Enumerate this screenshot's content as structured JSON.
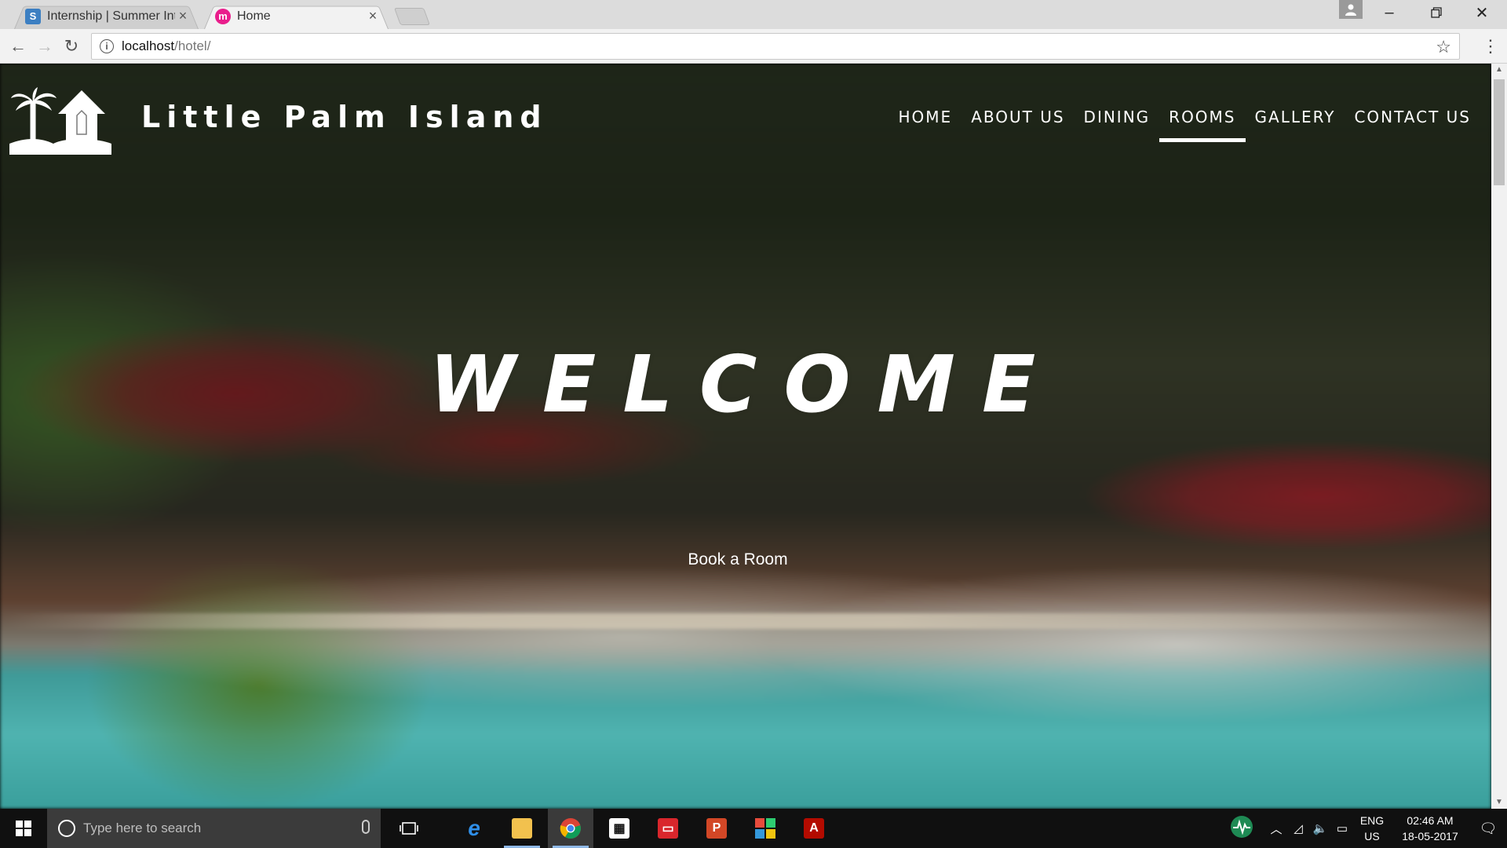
{
  "browser": {
    "tabs": [
      {
        "title": "Internship | Summer Inte",
        "favicon_letter": "S",
        "favicon_color": "#3c7fc2",
        "active": false
      },
      {
        "title": "Home",
        "favicon_letter": "m",
        "favicon_color": "#e91e8c",
        "active": true
      }
    ],
    "url_host": "localhost",
    "url_path": "/hotel/"
  },
  "site": {
    "title": "Little Palm Island",
    "nav": [
      {
        "label": "HOME",
        "active": false
      },
      {
        "label": "ABOUT US",
        "active": false
      },
      {
        "label": "DINING",
        "active": false
      },
      {
        "label": "ROOMS",
        "active": true
      },
      {
        "label": "GALLERY",
        "active": false
      },
      {
        "label": "CONTACT US",
        "active": false
      }
    ],
    "hero_heading": "WELCOME",
    "cta_label": "Book a Room"
  },
  "taskbar": {
    "search_placeholder": "Type here to search",
    "lang_line1": "ENG",
    "lang_line2": "US",
    "time": "02:46 AM",
    "date": "18-05-2017"
  },
  "colors": {
    "nav_active_underline": "#ffffff",
    "taskbar_bg": "#101010"
  }
}
